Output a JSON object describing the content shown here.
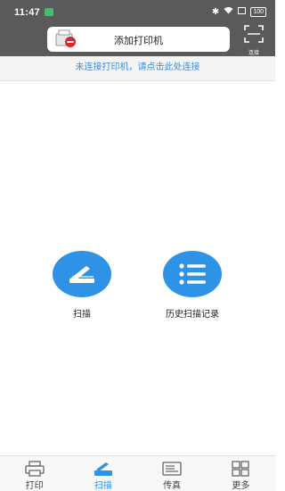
{
  "status_bar": {
    "time": "11:47",
    "battery": "100"
  },
  "header": {
    "add_printer_label": "添加打印机",
    "connect_label": "连接"
  },
  "hint": {
    "text": "未连接打印机，请点击此处连接"
  },
  "functions": [
    {
      "label": "扫描",
      "icon": "scanner-icon"
    },
    {
      "label": "历史扫描记录",
      "icon": "list-icon"
    }
  ],
  "bottom_nav": {
    "items": [
      {
        "label": "打印",
        "icon": "printer-icon",
        "active": false
      },
      {
        "label": "扫描",
        "icon": "scan-icon",
        "active": true
      },
      {
        "label": "传真",
        "icon": "fax-icon",
        "active": false
      },
      {
        "label": "更多",
        "icon": "grid-icon",
        "active": false
      }
    ]
  },
  "colors": {
    "accent": "#2e92e6",
    "header_bg": "#5a5a5a",
    "hint_text": "#3a8fd9"
  }
}
